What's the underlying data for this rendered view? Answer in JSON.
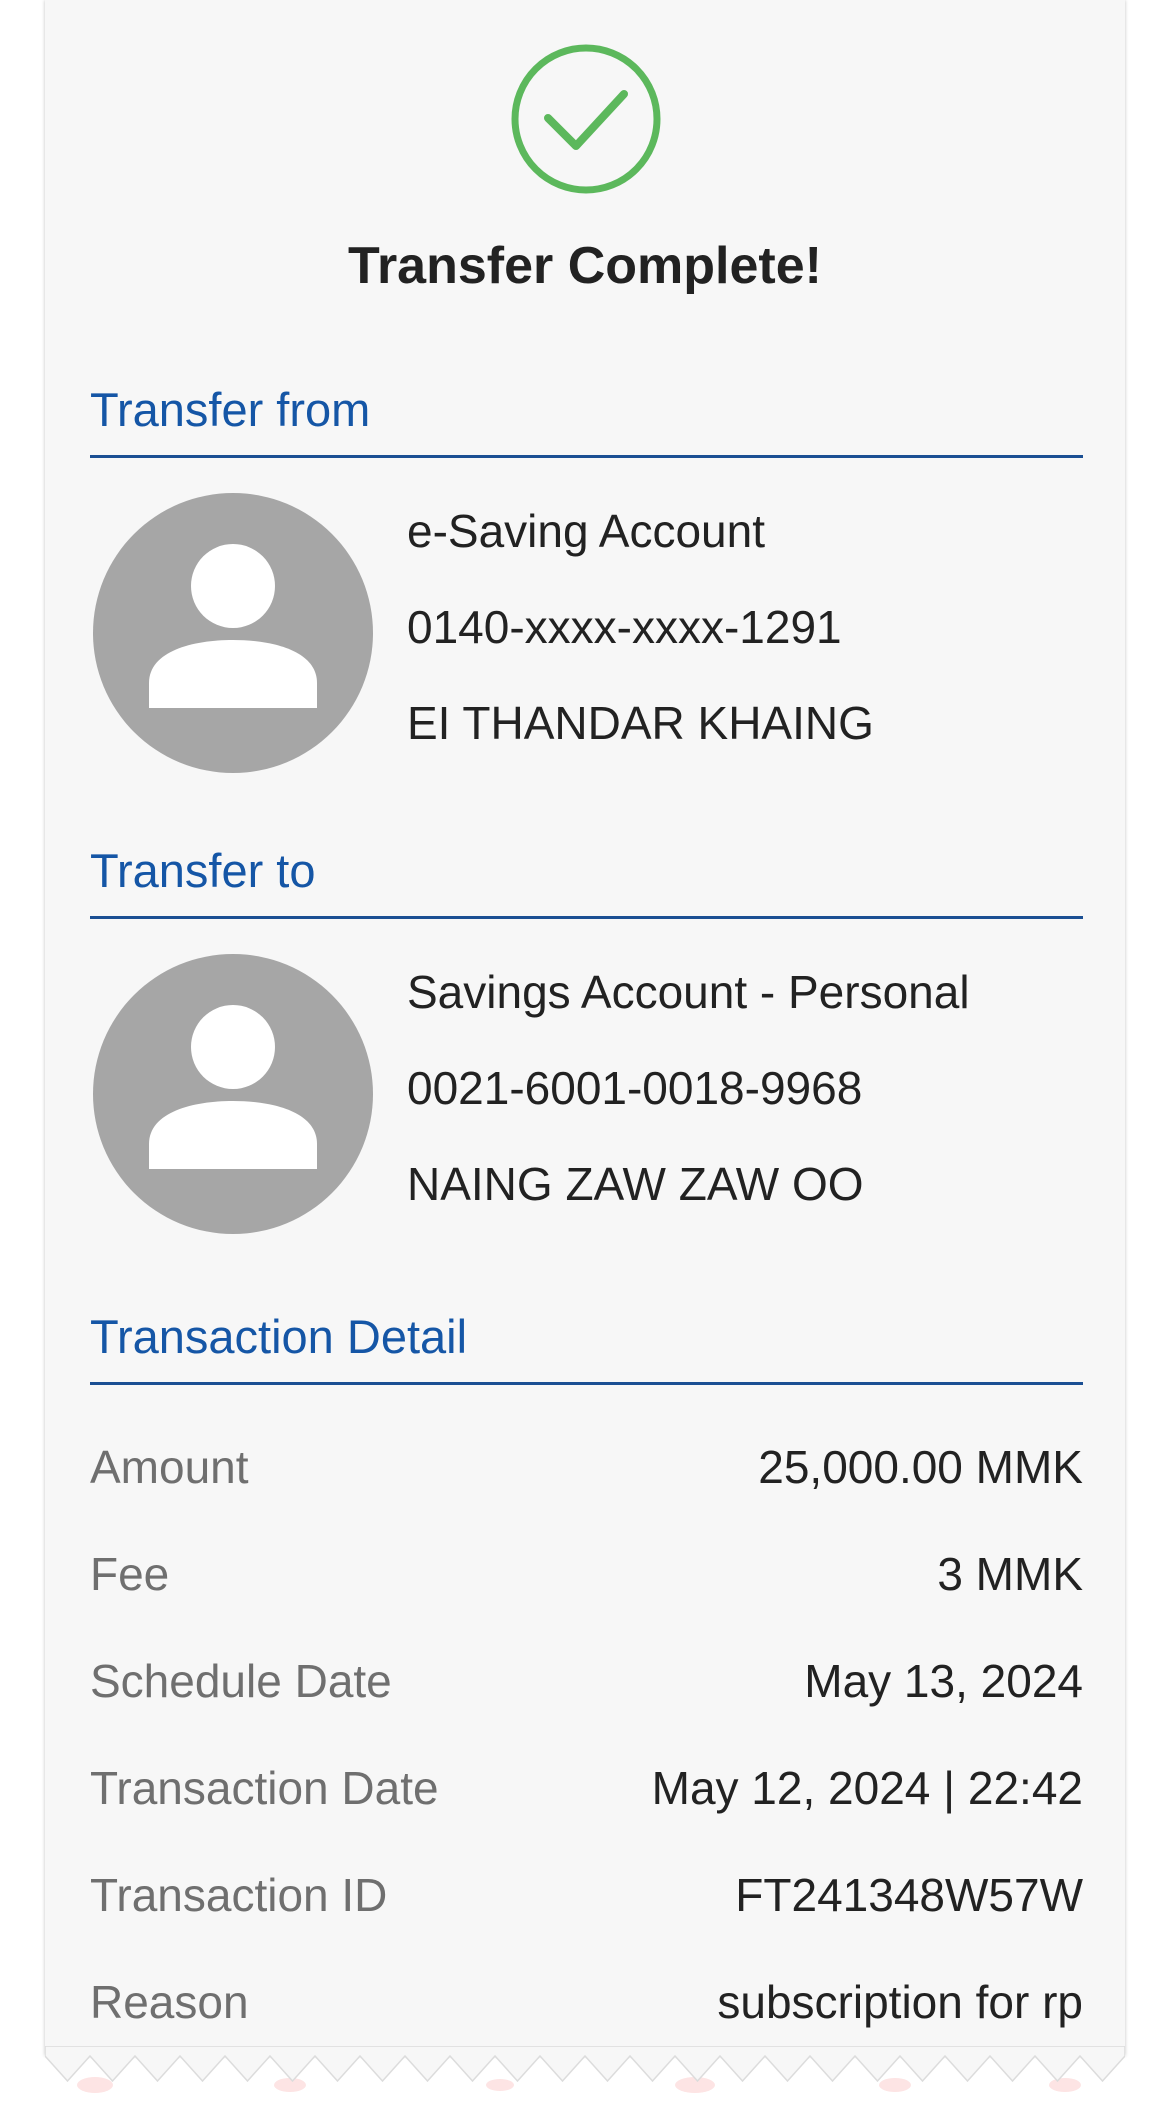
{
  "title": "Transfer Complete!",
  "colors": {
    "accent": "#1556a6",
    "success": "#5cb85c",
    "avatar_bg": "#a6a6a6"
  },
  "icons": {
    "status": "success-check-circle-icon",
    "avatar": "user-avatar-icon"
  },
  "transfer_from": {
    "header": "Transfer from",
    "account_type": "e-Saving Account",
    "account_number": "0140-xxxx-xxxx-1291",
    "account_name": "EI THANDAR KHAING"
  },
  "transfer_to": {
    "header": "Transfer to",
    "account_type": "Savings Account - Personal",
    "account_number": "0021-6001-0018-9968",
    "account_name": "NAING ZAW ZAW OO"
  },
  "transaction_detail": {
    "header": "Transaction Detail",
    "rows": [
      {
        "label": "Amount",
        "value": "25,000.00 MMK"
      },
      {
        "label": "Fee",
        "value": "3 MMK"
      },
      {
        "label": "Schedule Date",
        "value": "May 13, 2024"
      },
      {
        "label": "Transaction Date",
        "value": "May 12, 2024 | 22:42"
      },
      {
        "label": "Transaction ID",
        "value": "FT241348W57W"
      },
      {
        "label": "Reason",
        "value": "subscription for rp"
      }
    ]
  }
}
